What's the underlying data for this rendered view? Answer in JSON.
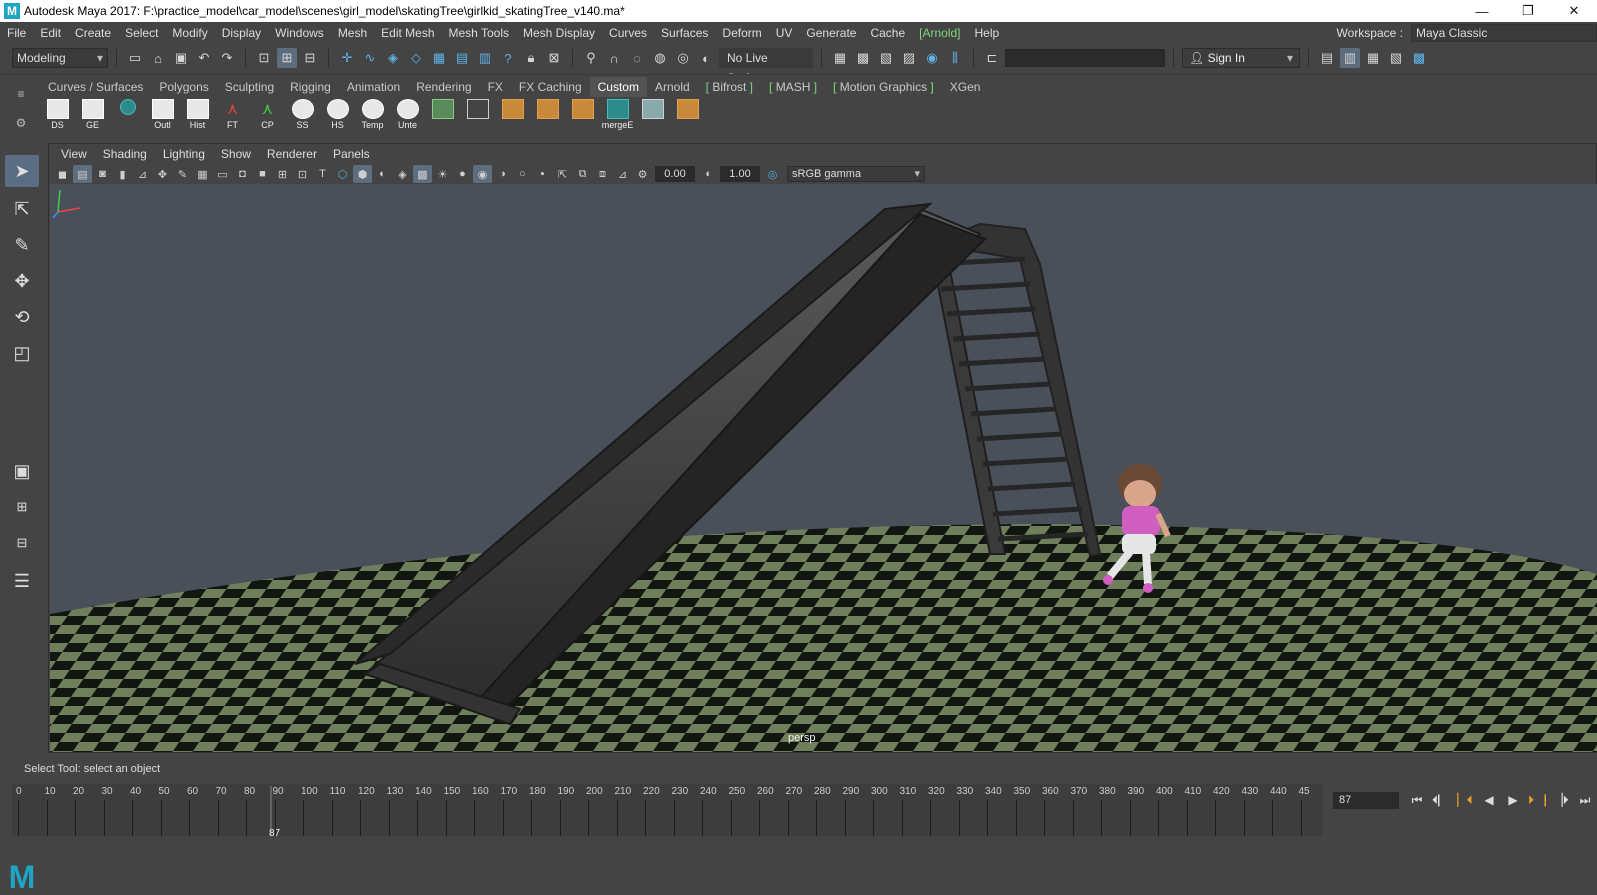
{
  "window": {
    "title": "Autodesk Maya 2017: F:\\practice_model\\car_model\\scenes\\girl_model\\skatingTree\\girlkid_skatingTree_v140.ma*",
    "logo_letter": "M",
    "controls": {
      "minimize": "—",
      "restore": "❐",
      "close": "✕"
    }
  },
  "menubar": {
    "items": [
      "File",
      "Edit",
      "Create",
      "Select",
      "Modify",
      "Display",
      "Windows",
      "Mesh",
      "Edit Mesh",
      "Mesh Tools",
      "Mesh Display",
      "Curves",
      "Surfaces",
      "Deform",
      "UV",
      "Generate",
      "Cache",
      "[Arnold]",
      "Help"
    ],
    "workspace_label": "Workspace :",
    "workspace_value": "Maya Classic"
  },
  "statusline": {
    "mode": "Modeling",
    "live_surface": "No Live Surface",
    "sign_in": "Sign In"
  },
  "shelf": {
    "tabs": [
      "Curves / Surfaces",
      "Polygons",
      "Sculpting",
      "Rigging",
      "Animation",
      "Rendering",
      "FX",
      "FX Caching",
      "Custom",
      "Arnold",
      "Bifrost",
      "MASH",
      "Motion Graphics",
      "XGen"
    ],
    "active_tab": "Custom",
    "icons": [
      {
        "label": "DS",
        "icon": "window-icon"
      },
      {
        "label": "GE",
        "icon": "window-icon"
      },
      {
        "label": "",
        "icon": "circle-icon"
      },
      {
        "label": "Outl",
        "icon": "outliner-icon"
      },
      {
        "label": "Hist",
        "icon": "history-icon"
      },
      {
        "label": "FT",
        "icon": "freeze-transform-icon"
      },
      {
        "label": "CP",
        "icon": "center-pivot-icon"
      },
      {
        "label": "SS",
        "icon": "eye-icon"
      },
      {
        "label": "HS",
        "icon": "eye-icon"
      },
      {
        "label": "Temp",
        "icon": "eye-icon"
      },
      {
        "label": "Unte",
        "icon": "eye-icon"
      },
      {
        "label": "",
        "icon": "checker-icon"
      },
      {
        "label": "",
        "icon": "uv-editor-icon"
      },
      {
        "label": "",
        "icon": "extrude-icon"
      },
      {
        "label": "",
        "icon": "bevel-icon"
      },
      {
        "label": "",
        "icon": "combine-icon"
      },
      {
        "label": "mergeE",
        "icon": "merge-icon"
      },
      {
        "label": "",
        "icon": "bridge-icon"
      },
      {
        "label": "",
        "icon": "slide-icon"
      }
    ]
  },
  "panel": {
    "menu": [
      "View",
      "Shading",
      "Lighting",
      "Show",
      "Renderer",
      "Panels"
    ],
    "exposure": "0.00",
    "gamma_value": "1.00",
    "color_space": "sRGB gamma",
    "camera_label": "persp"
  },
  "helpline": {
    "text": "Select Tool: select an object"
  },
  "timeslider": {
    "ticks": [
      "0",
      "10",
      "20",
      "30",
      "40",
      "50",
      "60",
      "70",
      "80",
      "90",
      "100",
      "110",
      "120",
      "130",
      "140",
      "150",
      "160",
      "170",
      "180",
      "190",
      "200",
      "210",
      "220",
      "230",
      "240",
      "250",
      "260",
      "270",
      "280",
      "290",
      "300",
      "310",
      "320",
      "330",
      "340",
      "350",
      "360",
      "370",
      "380",
      "390",
      "400",
      "410",
      "420",
      "430",
      "440",
      "45"
    ],
    "current_frame": "87",
    "current_frame_field": "87",
    "controls": [
      "go-to-start",
      "step-back-frame",
      "step-back-key",
      "play-backward",
      "play-forward",
      "step-forward-key",
      "step-forward-frame",
      "go-to-end"
    ]
  },
  "colors": {
    "accent": "#5d6d7e",
    "maya_blue": "#1fa5c3",
    "arnold_green": "#7fd67f",
    "viewport_bg": "#4a5059"
  }
}
